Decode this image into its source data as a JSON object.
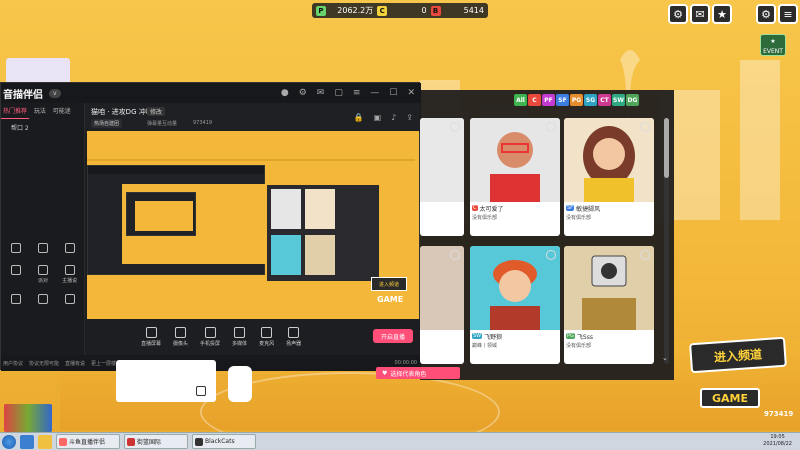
{
  "resources": [
    {
      "icon": "P",
      "value": "2062.2万",
      "color": "#67d36a"
    },
    {
      "icon": "C",
      "value": "0",
      "color": "#f2d33c"
    },
    {
      "icon": "B",
      "value": "5414",
      "color": "#e9483d"
    }
  ],
  "event_label": "EVENT",
  "app": {
    "logo": "音描伴侣",
    "logo_badge": "v",
    "side_tabs": [
      "热门推荐",
      "玩法",
      "可能迷"
    ],
    "side_item": "帮口 2",
    "side_grid": [
      "",
      "",
      "",
      "",
      "派对",
      "主播说",
      "",
      "",
      "",
      "",
      "",
      "",
      "",
      "",
      ""
    ],
    "channel_title": "猫咱 · 进攻DG 冲啊",
    "channel_tag": "修改",
    "channel_btn": "热场自建团",
    "channel_info": "弹幕量互动量",
    "channel_id": "973419",
    "tools": [
      "直播屏幕",
      "摄像头",
      "手机投屏",
      "多媒体",
      "麦克风",
      "扬声器"
    ],
    "start_label": "开启直播",
    "status_time": "00:00:00",
    "status_texts": [
      "用户协议",
      "协议无限可能",
      "直播有说",
      "更上一层楼"
    ]
  },
  "filters": [
    {
      "label": "All",
      "color": "#3fb34f"
    },
    {
      "label": "C",
      "color": "#e9483d"
    },
    {
      "label": "PF",
      "color": "#c43bd1"
    },
    {
      "label": "SF",
      "color": "#3b7ee0"
    },
    {
      "label": "PG",
      "color": "#e58d2e"
    },
    {
      "label": "SG",
      "color": "#2ea3c2"
    },
    {
      "label": "CT",
      "color": "#ce3a8f"
    },
    {
      "label": "SW",
      "color": "#2eaa82"
    },
    {
      "label": "DG",
      "color": "#4fa65b"
    }
  ],
  "cards": [
    {
      "lvl": "",
      "name": "",
      "club": "",
      "color": "#e9483d",
      "art": "#e8e8e8"
    },
    {
      "lvl": "C",
      "name": "太可爱了",
      "club": "没有俱乐部",
      "color": "#e9483d",
      "art": "#e6e6e6"
    },
    {
      "lvl": "SF",
      "name": "敏捷脚风",
      "club": "没有俱乐部",
      "color": "#3b7ee0",
      "art": "#f1e2c8"
    },
    {
      "lvl": "",
      "name": "",
      "club": "",
      "color": "#e9483d",
      "art": "#d9c8b8"
    },
    {
      "lvl": "SW",
      "name": "飞野狼",
      "club": "巅峰丨领域",
      "color": "#2ea3c2",
      "art": "#56c8d8"
    },
    {
      "lvl": "PG",
      "name": "飞Sss",
      "club": "没有俱乐部",
      "color": "#4fa65b",
      "art": "#e0cfa8"
    }
  ],
  "select_label": "选择代表角色",
  "enter_label": "进入频道",
  "game_sign": "GAME",
  "room_id": "973419",
  "taskbar": {
    "apps": [
      "斗鱼直播伴侣",
      "街篮国际",
      "BlackCats"
    ],
    "time": "19:05",
    "date": "2021/08/22"
  }
}
